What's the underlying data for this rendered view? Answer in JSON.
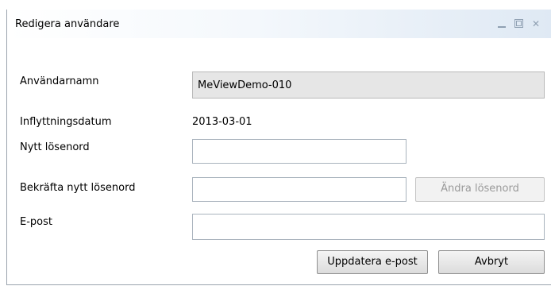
{
  "window": {
    "title": "Redigera användare",
    "controls": {
      "minimize": "minimize-icon",
      "maximize": "maximize-icon",
      "close": "close-icon"
    }
  },
  "form": {
    "username": {
      "label": "Användarnamn",
      "value": "MeViewDemo-010"
    },
    "move_in_date": {
      "label": "Inflyttningsdatum",
      "value": "2013-03-01"
    },
    "new_password": {
      "label": "Nytt lösenord",
      "value": ""
    },
    "confirm_password": {
      "label": "Bekräfta nytt lösenord",
      "value": ""
    },
    "email": {
      "label": "E-post",
      "value": ""
    }
  },
  "buttons": {
    "change_password": "Ändra lösenord",
    "update_email": "Uppdatera e-post",
    "cancel": "Avbryt"
  },
  "colors": {
    "title_gradient_end": "#dfe9f4",
    "readonly_field": "#e6e6e6",
    "border": "#a9b3bd"
  }
}
